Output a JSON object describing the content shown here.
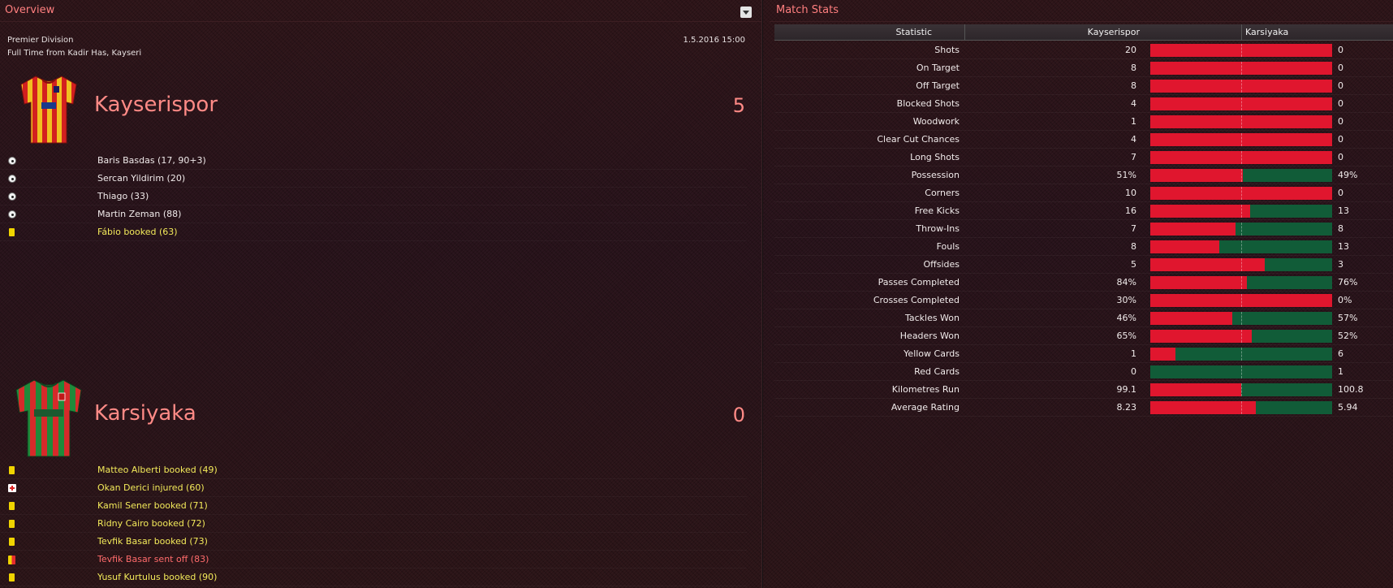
{
  "overview": {
    "title": "Overview",
    "competition": "Premier Division",
    "date": "1.5.2016 15:00",
    "status": "Full Time from Kadir Has, Kayseri",
    "home": {
      "name": "Kayserispor",
      "score": "5",
      "kit_colors": [
        "#f0c020",
        "#d3201f"
      ],
      "events": [
        {
          "type": "goal",
          "icon": "ball-icon",
          "text": "Baris Basdas (17, 90+3)"
        },
        {
          "type": "goal",
          "icon": "ball-icon",
          "text": "Sercan Yildirim (20)"
        },
        {
          "type": "goal",
          "icon": "ball-icon",
          "text": "Thiago (33)"
        },
        {
          "type": "goal",
          "icon": "ball-icon",
          "text": "Martin Zeman (88)"
        },
        {
          "type": "yellow",
          "icon": "yellow-card-icon",
          "text": "Fábio booked (63)"
        }
      ]
    },
    "away": {
      "name": "Karsiyaka",
      "score": "0",
      "kit_colors": [
        "#1f8a3a",
        "#d62a2a"
      ],
      "events": [
        {
          "type": "yellow",
          "icon": "yellow-card-icon",
          "text": "Matteo Alberti booked (49)"
        },
        {
          "type": "injury",
          "icon": "injury-icon",
          "text": "Okan Derici injured (60)"
        },
        {
          "type": "yellow",
          "icon": "yellow-card-icon",
          "text": "Kamil Sener booked (71)"
        },
        {
          "type": "yellow",
          "icon": "yellow-card-icon",
          "text": "Ridny Cairo booked (72)"
        },
        {
          "type": "yellow",
          "icon": "yellow-card-icon",
          "text": "Tevfik Basar booked (73)"
        },
        {
          "type": "red",
          "icon": "red-card-icon",
          "text": "Tevfik Basar sent off (83)"
        },
        {
          "type": "yellow",
          "icon": "yellow-card-icon",
          "text": "Yusuf Kurtulus booked (90)"
        }
      ]
    }
  },
  "match_stats": {
    "title": "Match Stats",
    "headers": {
      "statistic": "Statistic",
      "home": "Kayserispor",
      "away": "Karsiyaka"
    },
    "colors": {
      "home": "#e0162e",
      "away": "#115c38"
    },
    "rows": [
      {
        "label": "Shots",
        "home": "20",
        "away": "0",
        "home_share": 1.0
      },
      {
        "label": "On Target",
        "home": "8",
        "away": "0",
        "home_share": 1.0
      },
      {
        "label": "Off Target",
        "home": "8",
        "away": "0",
        "home_share": 1.0
      },
      {
        "label": "Blocked Shots",
        "home": "4",
        "away": "0",
        "home_share": 1.0
      },
      {
        "label": "Woodwork",
        "home": "1",
        "away": "0",
        "home_share": 1.0
      },
      {
        "label": "Clear Cut Chances",
        "home": "4",
        "away": "0",
        "home_share": 1.0
      },
      {
        "label": "Long Shots",
        "home": "7",
        "away": "0",
        "home_share": 1.0
      },
      {
        "label": "Possession",
        "home": "51%",
        "away": "49%",
        "home_share": 0.51
      },
      {
        "label": "Corners",
        "home": "10",
        "away": "0",
        "home_share": 1.0
      },
      {
        "label": "Free Kicks",
        "home": "16",
        "away": "13",
        "home_share": 0.55
      },
      {
        "label": "Throw-Ins",
        "home": "7",
        "away": "8",
        "home_share": 0.47
      },
      {
        "label": "Fouls",
        "home": "8",
        "away": "13",
        "home_share": 0.38
      },
      {
        "label": "Offsides",
        "home": "5",
        "away": "3",
        "home_share": 0.63
      },
      {
        "label": "Passes Completed",
        "home": "84%",
        "away": "76%",
        "home_share": 0.53
      },
      {
        "label": "Crosses Completed",
        "home": "30%",
        "away": "0%",
        "home_share": 1.0
      },
      {
        "label": "Tackles Won",
        "home": "46%",
        "away": "57%",
        "home_share": 0.45
      },
      {
        "label": "Headers Won",
        "home": "65%",
        "away": "52%",
        "home_share": 0.56
      },
      {
        "label": "Yellow Cards",
        "home": "1",
        "away": "6",
        "home_share": 0.14
      },
      {
        "label": "Red Cards",
        "home": "0",
        "away": "1",
        "home_share": 0.0
      },
      {
        "label": "Kilometres Run",
        "home": "99.1",
        "away": "100.8",
        "home_share": 0.5
      },
      {
        "label": "Average Rating",
        "home": "8.23",
        "away": "5.94",
        "home_share": 0.58
      }
    ]
  }
}
